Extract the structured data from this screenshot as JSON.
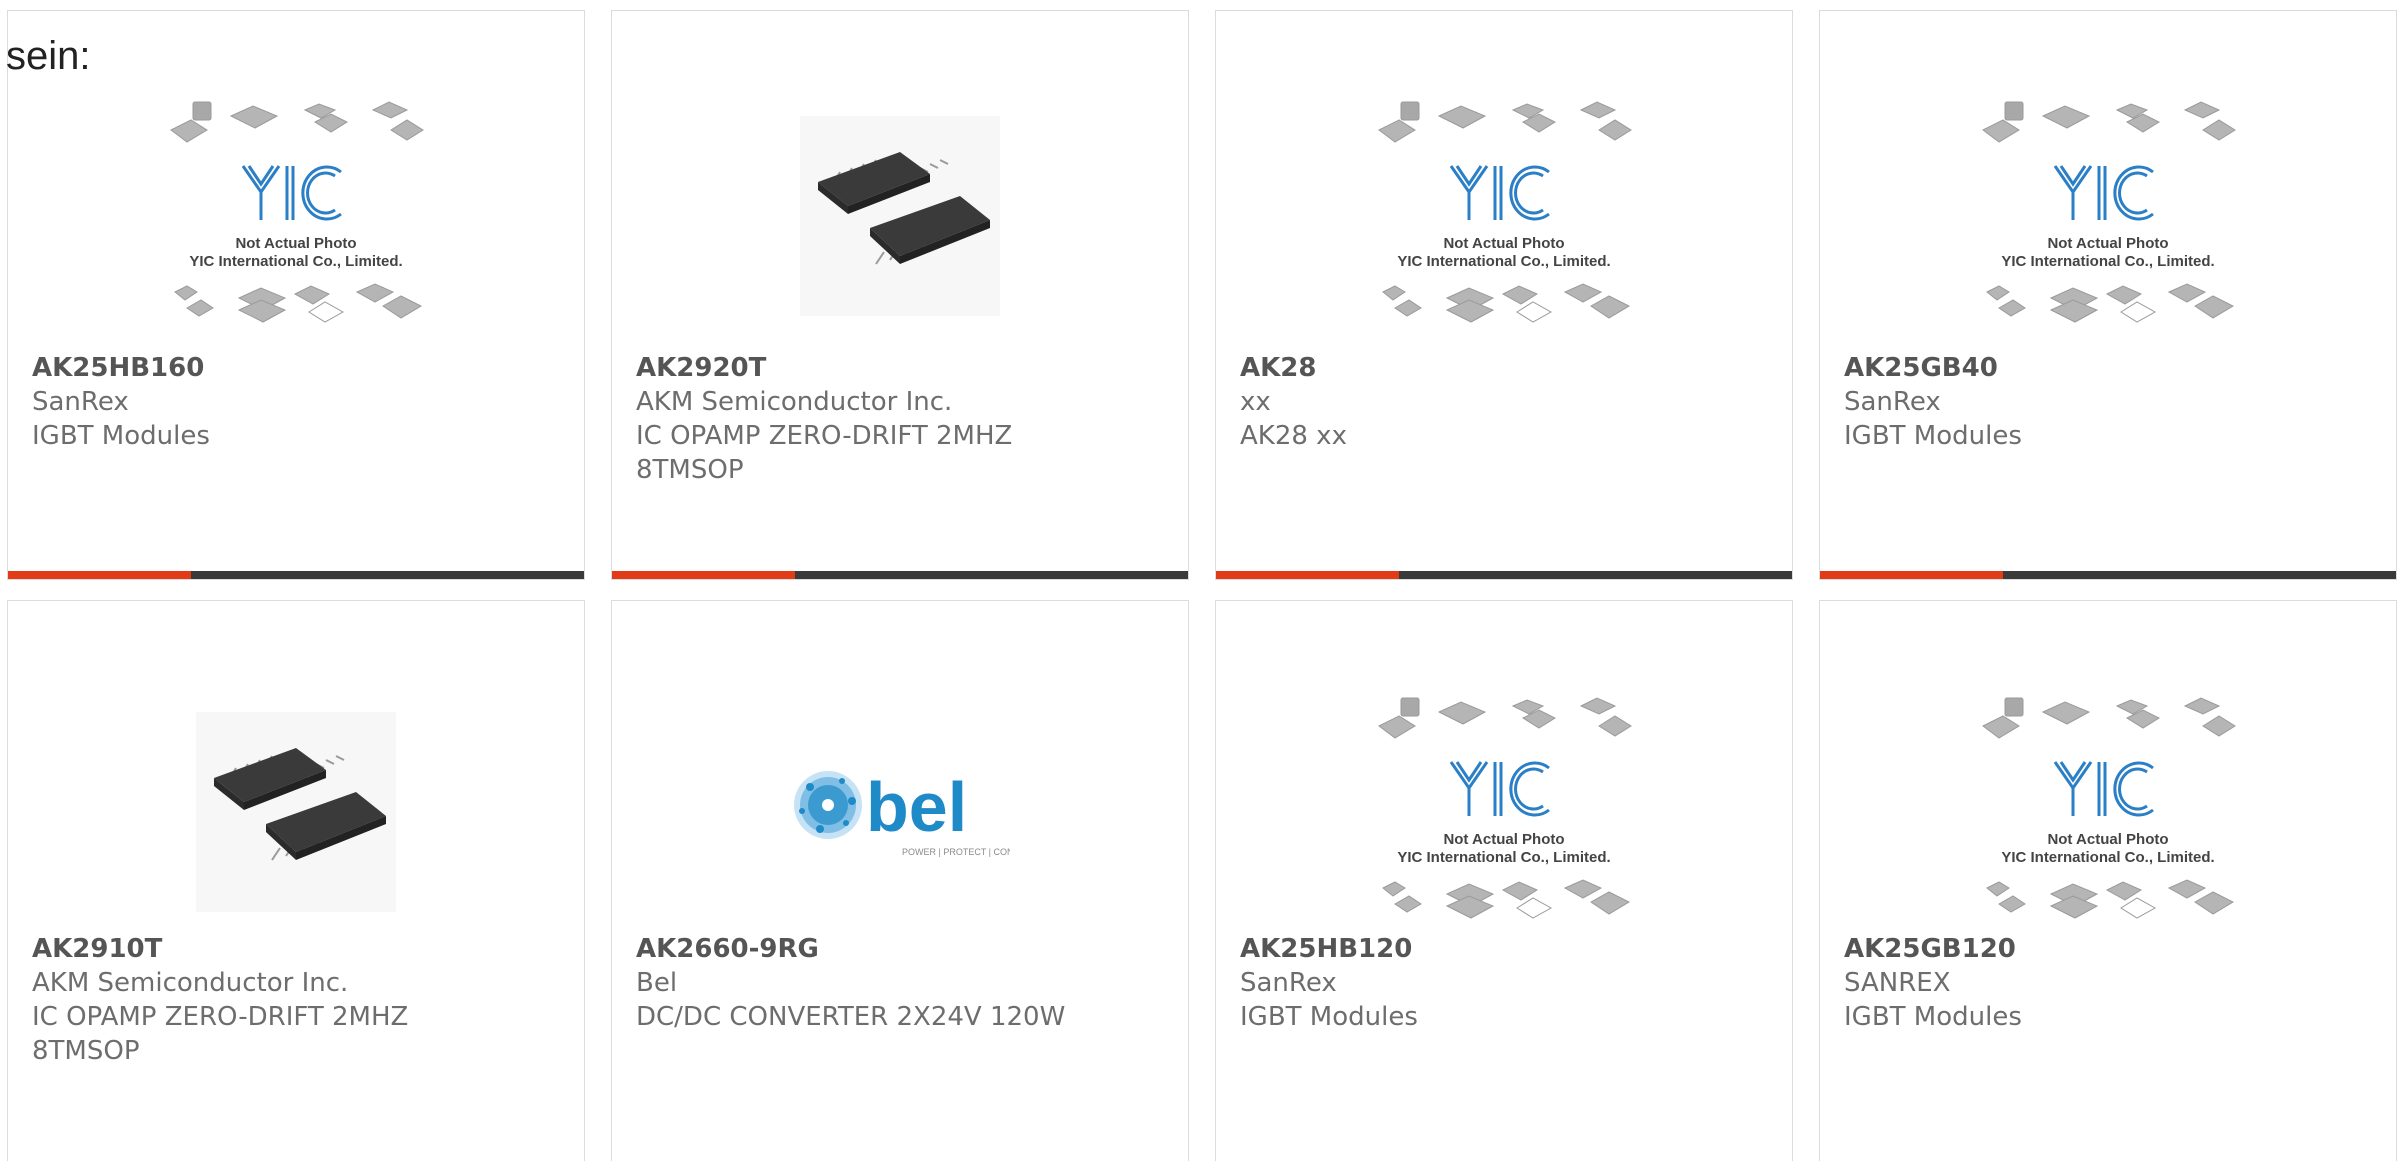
{
  "lead_text": "sein:",
  "placeholder": {
    "line1": "Not Actual Photo",
    "line2": "YIC International Co., Limited."
  },
  "bel_logo": {
    "word": "bel",
    "tagline": "POWER | PROTECT | CONNECT"
  },
  "colors": {
    "accent": "#e13b17",
    "bar": "#3a3a3a",
    "yic_blue": "#2a7fc6",
    "bel_blue": "#1e8ac8",
    "text": "#6d6d6d"
  },
  "products": [
    {
      "part": "AK25HB160",
      "maker": "SanRex",
      "desc": "IGBT Modules",
      "image": "yic-placeholder-icon"
    },
    {
      "part": "AK2920T",
      "maker": "AKM Semiconductor Inc.",
      "desc": "IC OPAMP ZERO-DRIFT 2MHZ 8TMSOP",
      "image": "tmsop-chip-icon"
    },
    {
      "part": "AK28",
      "maker": "xx",
      "desc": "AK28 xx",
      "image": "yic-placeholder-icon"
    },
    {
      "part": "AK25GB40",
      "maker": "SanRex",
      "desc": "IGBT Modules",
      "image": "yic-placeholder-icon"
    },
    {
      "part": "AK2910T",
      "maker": "AKM Semiconductor Inc.",
      "desc": "IC OPAMP ZERO-DRIFT 2MHZ 8TMSOP",
      "image": "tmsop-chip-icon"
    },
    {
      "part": "AK2660-9RG",
      "maker": "Bel",
      "desc": "DC/DC CONVERTER 2X24V 120W",
      "image": "bel-logo-icon"
    },
    {
      "part": "AK25HB120",
      "maker": "SanRex",
      "desc": "IGBT Modules",
      "image": "yic-placeholder-icon"
    },
    {
      "part": "AK25GB120",
      "maker": "SANREX",
      "desc": "IGBT Modules",
      "image": "yic-placeholder-icon"
    }
  ]
}
